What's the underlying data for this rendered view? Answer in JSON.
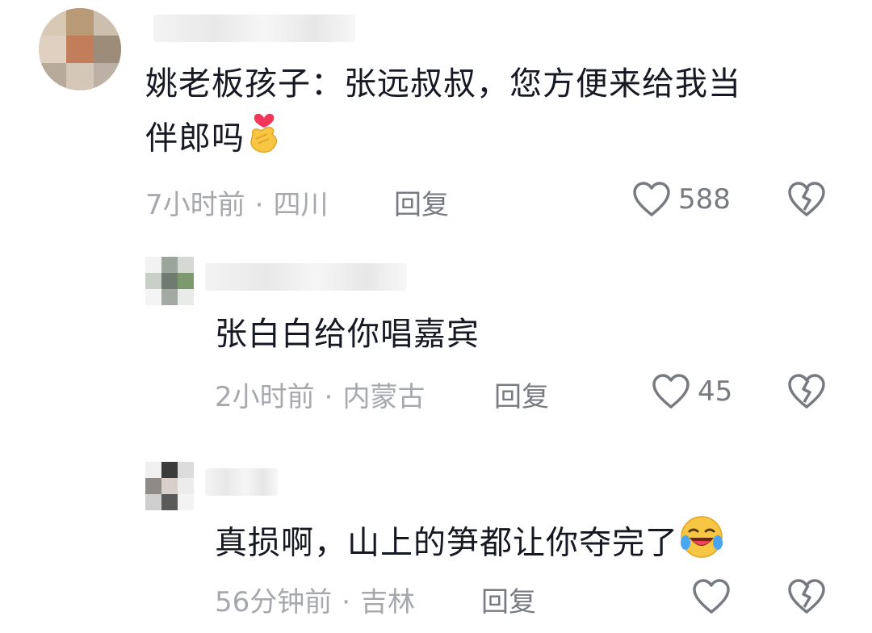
{
  "comments": [
    {
      "text_line1": "姚老板孩子：张远叔叔，您方便来给我当",
      "text_line2": "伴郎吗",
      "emoji": "finger-heart-emoji",
      "time": "7小时前",
      "location": "四川",
      "reply_label": "回复",
      "likes": "588"
    },
    {
      "text": "张白白给你唱嘉宾",
      "time": "2小时前",
      "location": "内蒙古",
      "reply_label": "回复",
      "likes": "45"
    },
    {
      "text": "真损啊，山上的笋都让你夺完了",
      "emoji": "laughing-crying-emoji",
      "time": "56分钟前",
      "location": "吉林",
      "reply_label": "回复",
      "likes": ""
    }
  ],
  "meta_separator": "·",
  "colors": {
    "text": "#161823",
    "meta": "#a6a8ad",
    "action": "#777a80"
  }
}
